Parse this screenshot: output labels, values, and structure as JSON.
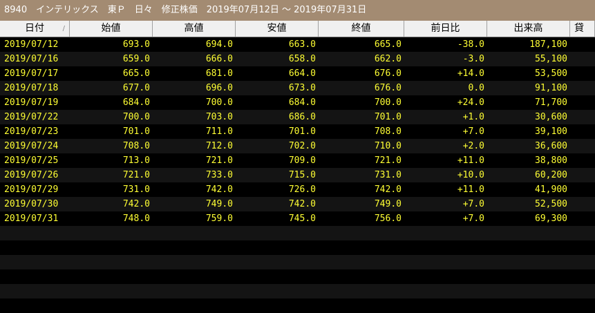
{
  "title": "8940　インテリックス　東Ｐ　日々　修正株価　2019年07月12日 ～ 2019年07月31日",
  "columns": [
    "日付",
    "始値",
    "高値",
    "安値",
    "終値",
    "前日比",
    "出来高",
    "貸"
  ],
  "sort_indicator": "/",
  "rows": [
    [
      "2019/07/12",
      "693.0",
      "694.0",
      "663.0",
      "665.0",
      "-38.0",
      "187,100"
    ],
    [
      "2019/07/16",
      "659.0",
      "666.0",
      "658.0",
      "662.0",
      "-3.0",
      "55,100"
    ],
    [
      "2019/07/17",
      "665.0",
      "681.0",
      "664.0",
      "676.0",
      "+14.0",
      "53,500"
    ],
    [
      "2019/07/18",
      "677.0",
      "696.0",
      "673.0",
      "676.0",
      "0.0",
      "91,100"
    ],
    [
      "2019/07/19",
      "684.0",
      "700.0",
      "684.0",
      "700.0",
      "+24.0",
      "71,700"
    ],
    [
      "2019/07/22",
      "700.0",
      "703.0",
      "686.0",
      "701.0",
      "+1.0",
      "30,600"
    ],
    [
      "2019/07/23",
      "701.0",
      "711.0",
      "701.0",
      "708.0",
      "+7.0",
      "39,100"
    ],
    [
      "2019/07/24",
      "708.0",
      "712.0",
      "702.0",
      "710.0",
      "+2.0",
      "36,600"
    ],
    [
      "2019/07/25",
      "713.0",
      "721.0",
      "709.0",
      "721.0",
      "+11.0",
      "38,800"
    ],
    [
      "2019/07/26",
      "721.0",
      "733.0",
      "715.0",
      "731.0",
      "+10.0",
      "60,200"
    ],
    [
      "2019/07/29",
      "731.0",
      "742.0",
      "726.0",
      "742.0",
      "+11.0",
      "41,900"
    ],
    [
      "2019/07/30",
      "742.0",
      "749.0",
      "742.0",
      "749.0",
      "+7.0",
      "52,500"
    ],
    [
      "2019/07/31",
      "748.0",
      "759.0",
      "745.0",
      "756.0",
      "+7.0",
      "69,300"
    ]
  ],
  "colors": {
    "title_bg": "#a38b72",
    "text": "#ffff33",
    "row_dark": "#000000",
    "row_alt": "#141414"
  }
}
